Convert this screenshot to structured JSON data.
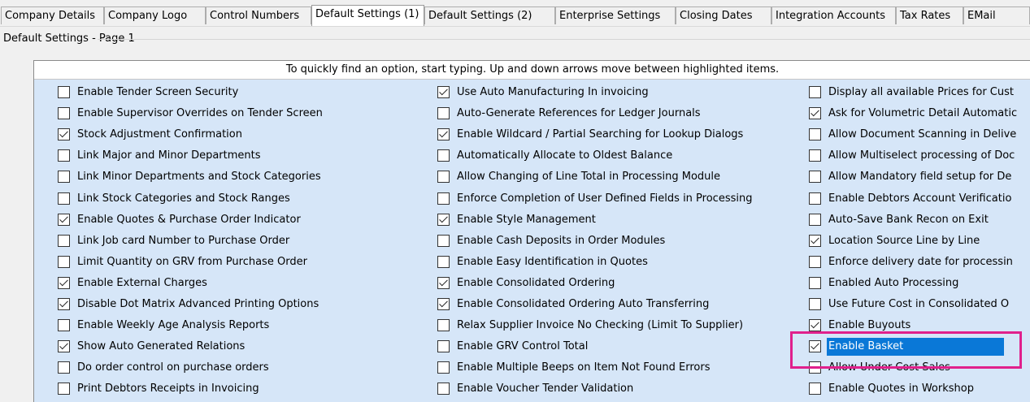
{
  "tabs": [
    {
      "label": "Company Details"
    },
    {
      "label": "Company Logo"
    },
    {
      "label": "Control Numbers"
    },
    {
      "label": "Default Settings (1)",
      "active": true
    },
    {
      "label": "Default Settings (2)"
    },
    {
      "label": "Enterprise Settings"
    },
    {
      "label": "Closing Dates"
    },
    {
      "label": "Integration Accounts"
    },
    {
      "label": "Tax Rates"
    },
    {
      "label": "EMail"
    }
  ],
  "groupbox": {
    "title": "Default Settings - Page 1"
  },
  "hint": "To quickly find an option, start typing. Up and down arrows move between highlighted items.",
  "columns": [
    [
      {
        "label": "Enable Tender Screen Security",
        "checked": false
      },
      {
        "label": "Enable Supervisor Overrides on Tender Screen",
        "checked": false
      },
      {
        "label": "Stock Adjustment Confirmation",
        "checked": true
      },
      {
        "label": "Link Major and Minor Departments",
        "checked": false
      },
      {
        "label": "Link Minor Departments and Stock Categories",
        "checked": false
      },
      {
        "label": "Link Stock Categories and Stock Ranges",
        "checked": false
      },
      {
        "label": "Enable Quotes & Purchase Order Indicator",
        "checked": true
      },
      {
        "label": "Link Job card Number to Purchase Order",
        "checked": false
      },
      {
        "label": "Limit Quantity on GRV from Purchase Order",
        "checked": false
      },
      {
        "label": "Enable External Charges",
        "checked": true
      },
      {
        "label": "Disable Dot Matrix Advanced Printing Options",
        "checked": true
      },
      {
        "label": "Enable Weekly Age Analysis Reports",
        "checked": false
      },
      {
        "label": "Show Auto Generated Relations",
        "checked": true
      },
      {
        "label": "Do order control on purchase orders",
        "checked": false
      },
      {
        "label": "Print Debtors Receipts in Invoicing",
        "checked": false
      }
    ],
    [
      {
        "label": "Use Auto Manufacturing In invoicing",
        "checked": true
      },
      {
        "label": "Auto-Generate References for Ledger Journals",
        "checked": false
      },
      {
        "label": "Enable Wildcard / Partial Searching for Lookup Dialogs",
        "checked": true
      },
      {
        "label": "Automatically Allocate to Oldest Balance",
        "checked": false
      },
      {
        "label": "Allow Changing of Line Total in Processing Module",
        "checked": false
      },
      {
        "label": "Enforce Completion of User Defined Fields in Processing",
        "checked": false
      },
      {
        "label": "Enable Style Management",
        "checked": true
      },
      {
        "label": "Enable Cash Deposits in Order Modules",
        "checked": false
      },
      {
        "label": "Enable Easy Identification in Quotes",
        "checked": false
      },
      {
        "label": "Enable Consolidated Ordering",
        "checked": true
      },
      {
        "label": "Enable Consolidated Ordering Auto Transferring",
        "checked": true
      },
      {
        "label": "Relax Supplier Invoice No Checking (Limit To Supplier)",
        "checked": false
      },
      {
        "label": "Enable GRV Control Total",
        "checked": false
      },
      {
        "label": "Enable Multiple Beeps on Item Not Found Errors",
        "checked": false
      },
      {
        "label": "Enable Voucher Tender Validation",
        "checked": false
      }
    ],
    [
      {
        "label": "Display all available Prices for Cust",
        "checked": false
      },
      {
        "label": "Ask for Volumetric Detail Automatic",
        "checked": true
      },
      {
        "label": "Allow Document Scanning in Delive",
        "checked": false
      },
      {
        "label": "Allow Multiselect processing of Doc",
        "checked": false
      },
      {
        "label": "Allow Mandatory field setup for De",
        "checked": false
      },
      {
        "label": "Enable Debtors Account Verificatio",
        "checked": false
      },
      {
        "label": "Auto-Save Bank Recon on Exit",
        "checked": false
      },
      {
        "label": "Location Source Line by Line",
        "checked": true
      },
      {
        "label": "Enforce delivery date for processin",
        "checked": false
      },
      {
        "label": "Enabled Auto Processing",
        "checked": false
      },
      {
        "label": "Use Future Cost in Consolidated O",
        "checked": false
      },
      {
        "label": "Enable Buyouts",
        "checked": true
      },
      {
        "label": "Enable Basket",
        "checked": true,
        "selected": true
      },
      {
        "label": "Allow Under Cost Sales",
        "checked": false
      },
      {
        "label": "Enable Quotes in Workshop",
        "checked": false
      }
    ]
  ],
  "colors": {
    "panel": "#d6e6f8",
    "selection": "#0a78d7",
    "highlight_box": "#e0208c"
  }
}
